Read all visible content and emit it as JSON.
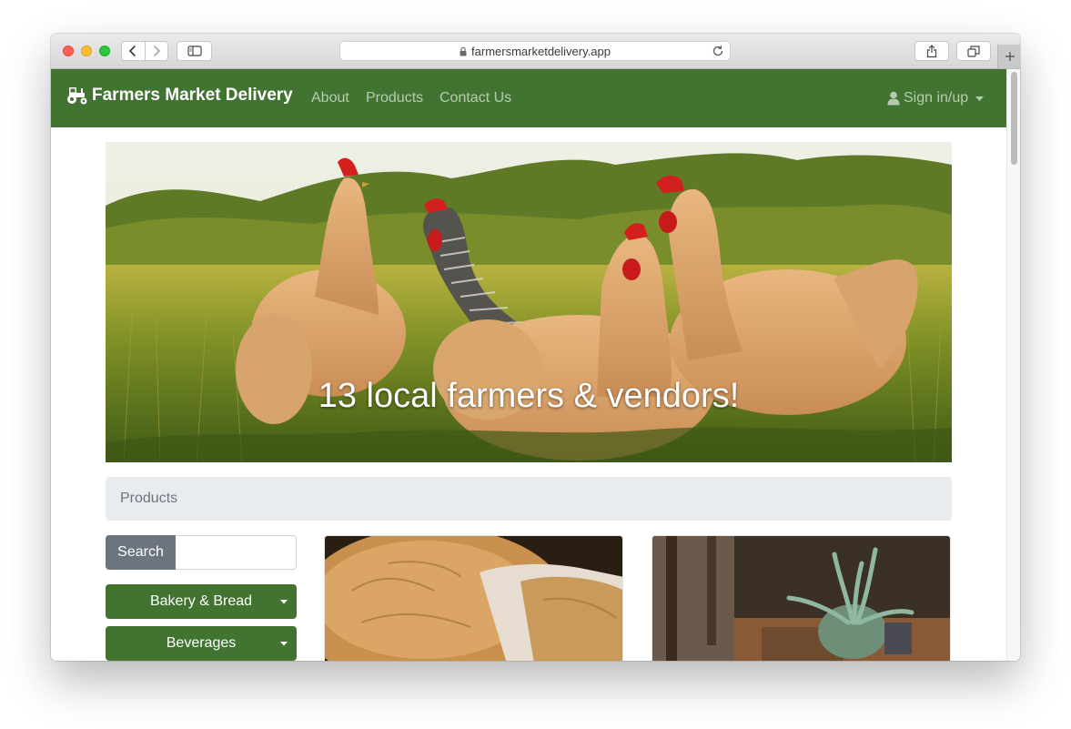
{
  "browser": {
    "url": "farmersmarketdelivery.app",
    "icons": [
      "back-icon",
      "forward-icon",
      "sidebar-icon",
      "lock-icon",
      "reload-icon",
      "share-icon",
      "tabs-icon",
      "plus-icon"
    ]
  },
  "navbar": {
    "brand": "Farmers Market Delivery",
    "links": [
      "About",
      "Products",
      "Contact Us"
    ],
    "signin": "Sign in/up",
    "color": "#417431"
  },
  "hero": {
    "caption": "13 local farmers & vendors!"
  },
  "breadcrumb": {
    "label": "Products"
  },
  "sidebar": {
    "search_label": "Search",
    "search_value": "",
    "categories": [
      "Bakery & Bread",
      "Beverages"
    ]
  }
}
